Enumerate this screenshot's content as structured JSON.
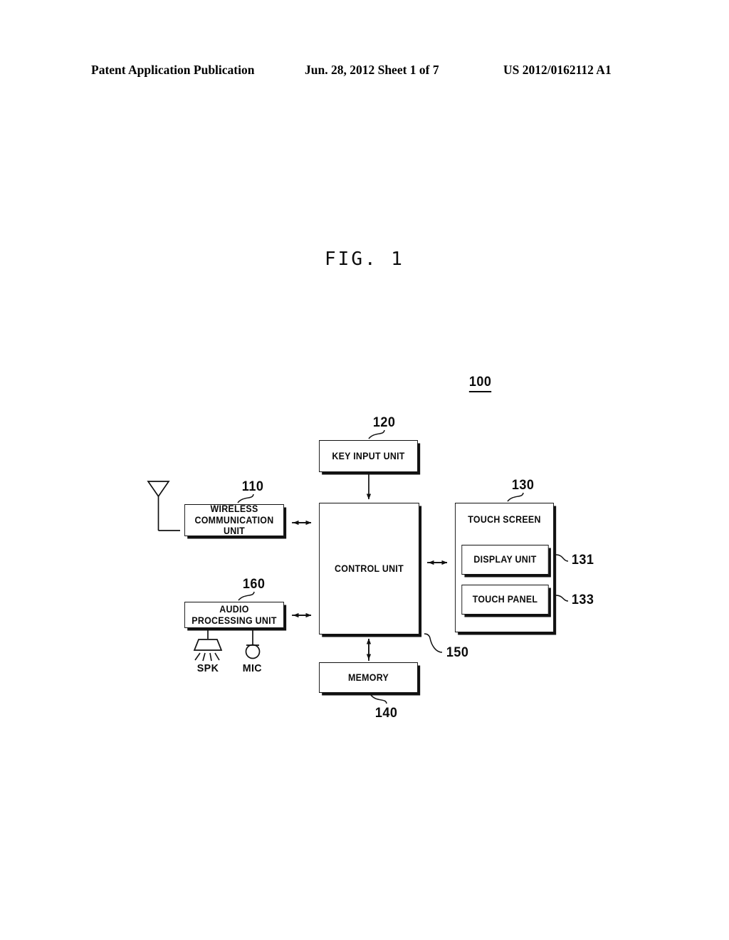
{
  "header": {
    "publication": "Patent Application Publication",
    "date_sheet": "Jun. 28, 2012  Sheet 1 of 7",
    "pub_number": "US 2012/0162112 A1"
  },
  "figure": {
    "caption": "FIG. 1",
    "system_ref": "100"
  },
  "blocks": [
    {
      "id": "key_input",
      "label": "KEY INPUT UNIT",
      "ref": "120"
    },
    {
      "id": "wireless",
      "label": "WIRELESS\nCOMMUNICATION UNIT",
      "ref": "110"
    },
    {
      "id": "control",
      "label": "CONTROL UNIT",
      "ref": "150"
    },
    {
      "id": "touchscreen",
      "label": "TOUCH SCREEN",
      "ref": "130"
    },
    {
      "id": "display",
      "label": "DISPLAY UNIT",
      "ref": "131"
    },
    {
      "id": "touchpanel",
      "label": "TOUCH PANEL",
      "ref": "133"
    },
    {
      "id": "audio",
      "label": "AUDIO PROCESSING UNIT",
      "ref": "160"
    },
    {
      "id": "memory",
      "label": "MEMORY",
      "ref": "140"
    }
  ],
  "block_labels": {
    "key_input": "KEY INPUT UNIT",
    "wireless_line1": "WIRELESS",
    "wireless_line2": "COMMUNICATION UNIT",
    "control": "CONTROL UNIT",
    "touchscreen": "TOUCH SCREEN",
    "display": "DISPLAY UNIT",
    "touchpanel": "TOUCH PANEL",
    "audio": "AUDIO PROCESSING UNIT",
    "memory": "MEMORY"
  },
  "refs": {
    "system": "100",
    "wireless": "110",
    "key_input": "120",
    "touchscreen": "130",
    "display": "131",
    "touchpanel": "133",
    "memory": "140",
    "control": "150",
    "audio": "160"
  },
  "peripherals": {
    "speaker_label": "SPK",
    "mic_label": "MIC",
    "antenna_icon": "antenna-icon",
    "speaker_icon": "speaker-icon",
    "mic_icon": "mic-icon"
  },
  "connections": [
    {
      "from": "key_input",
      "to": "control",
      "type": "single-arrow-down"
    },
    {
      "from": "wireless",
      "to": "control",
      "type": "double-arrow"
    },
    {
      "from": "audio",
      "to": "control",
      "type": "double-arrow"
    },
    {
      "from": "control",
      "to": "touchscreen",
      "type": "double-arrow"
    },
    {
      "from": "control",
      "to": "memory",
      "type": "double-arrow-vertical"
    },
    {
      "from": "antenna",
      "to": "wireless",
      "type": "plain-line"
    },
    {
      "from": "audio",
      "to": "speaker",
      "type": "plain-line"
    },
    {
      "from": "audio",
      "to": "mic",
      "type": "plain-line"
    }
  ],
  "colors": {
    "ink": "#0b0b0b",
    "paper": "#ffffff"
  }
}
